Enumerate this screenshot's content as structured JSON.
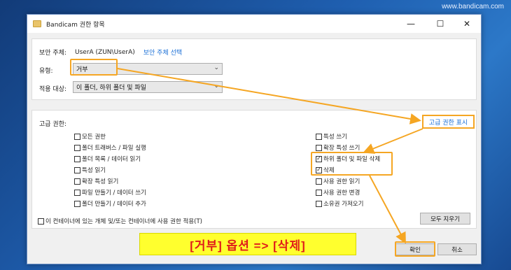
{
  "watermark": "www.bandicam.com",
  "window": {
    "title": "Bandicam 권한 항목",
    "controls": {
      "minimize": "—",
      "maximize": "☐",
      "close": "✕"
    }
  },
  "principal": {
    "label": "보안 주체:",
    "value": "UserA (ZUN\\UserA)",
    "link": "보안 주체 선택"
  },
  "type": {
    "label": "유형:",
    "value": "거부"
  },
  "applies": {
    "label": "적용 대상:",
    "value": "이 폴더, 하위 폴더 및 파일"
  },
  "advanced": {
    "label": "고급 권한:",
    "show_link": "고급 권한 표시",
    "left": [
      {
        "label": "모든 권한",
        "checked": false
      },
      {
        "label": "폴더 트래버스 / 파일 실행",
        "checked": false
      },
      {
        "label": "폴더 목록 / 데이터 읽기",
        "checked": false
      },
      {
        "label": "특성 읽기",
        "checked": false
      },
      {
        "label": "확장 특성 읽기",
        "checked": false
      },
      {
        "label": "파일 만들기 / 데이터 쓰기",
        "checked": false
      },
      {
        "label": "폴더 만들기 / 데이터 추가",
        "checked": false
      }
    ],
    "right": [
      {
        "label": "특성 쓰기",
        "checked": false
      },
      {
        "label": "확장 특성 쓰기",
        "checked": false
      },
      {
        "label": "하위 폴더 및 파일 삭제",
        "checked": true
      },
      {
        "label": "삭제",
        "checked": true
      },
      {
        "label": "사용 권한 읽기",
        "checked": false
      },
      {
        "label": "사용 권한 변경",
        "checked": false
      },
      {
        "label": "소유권 가져오기",
        "checked": false
      }
    ],
    "apply_only_label": "이 컨테이너에 있는 개체 및/또는 컨테이너에 사용 권한 적용(T)",
    "clear_all": "모두 지우기"
  },
  "buttons": {
    "ok": "확인",
    "cancel": "취소"
  },
  "banner": "[거부] 옵션 => [삭제]",
  "accent": "#f5a623"
}
